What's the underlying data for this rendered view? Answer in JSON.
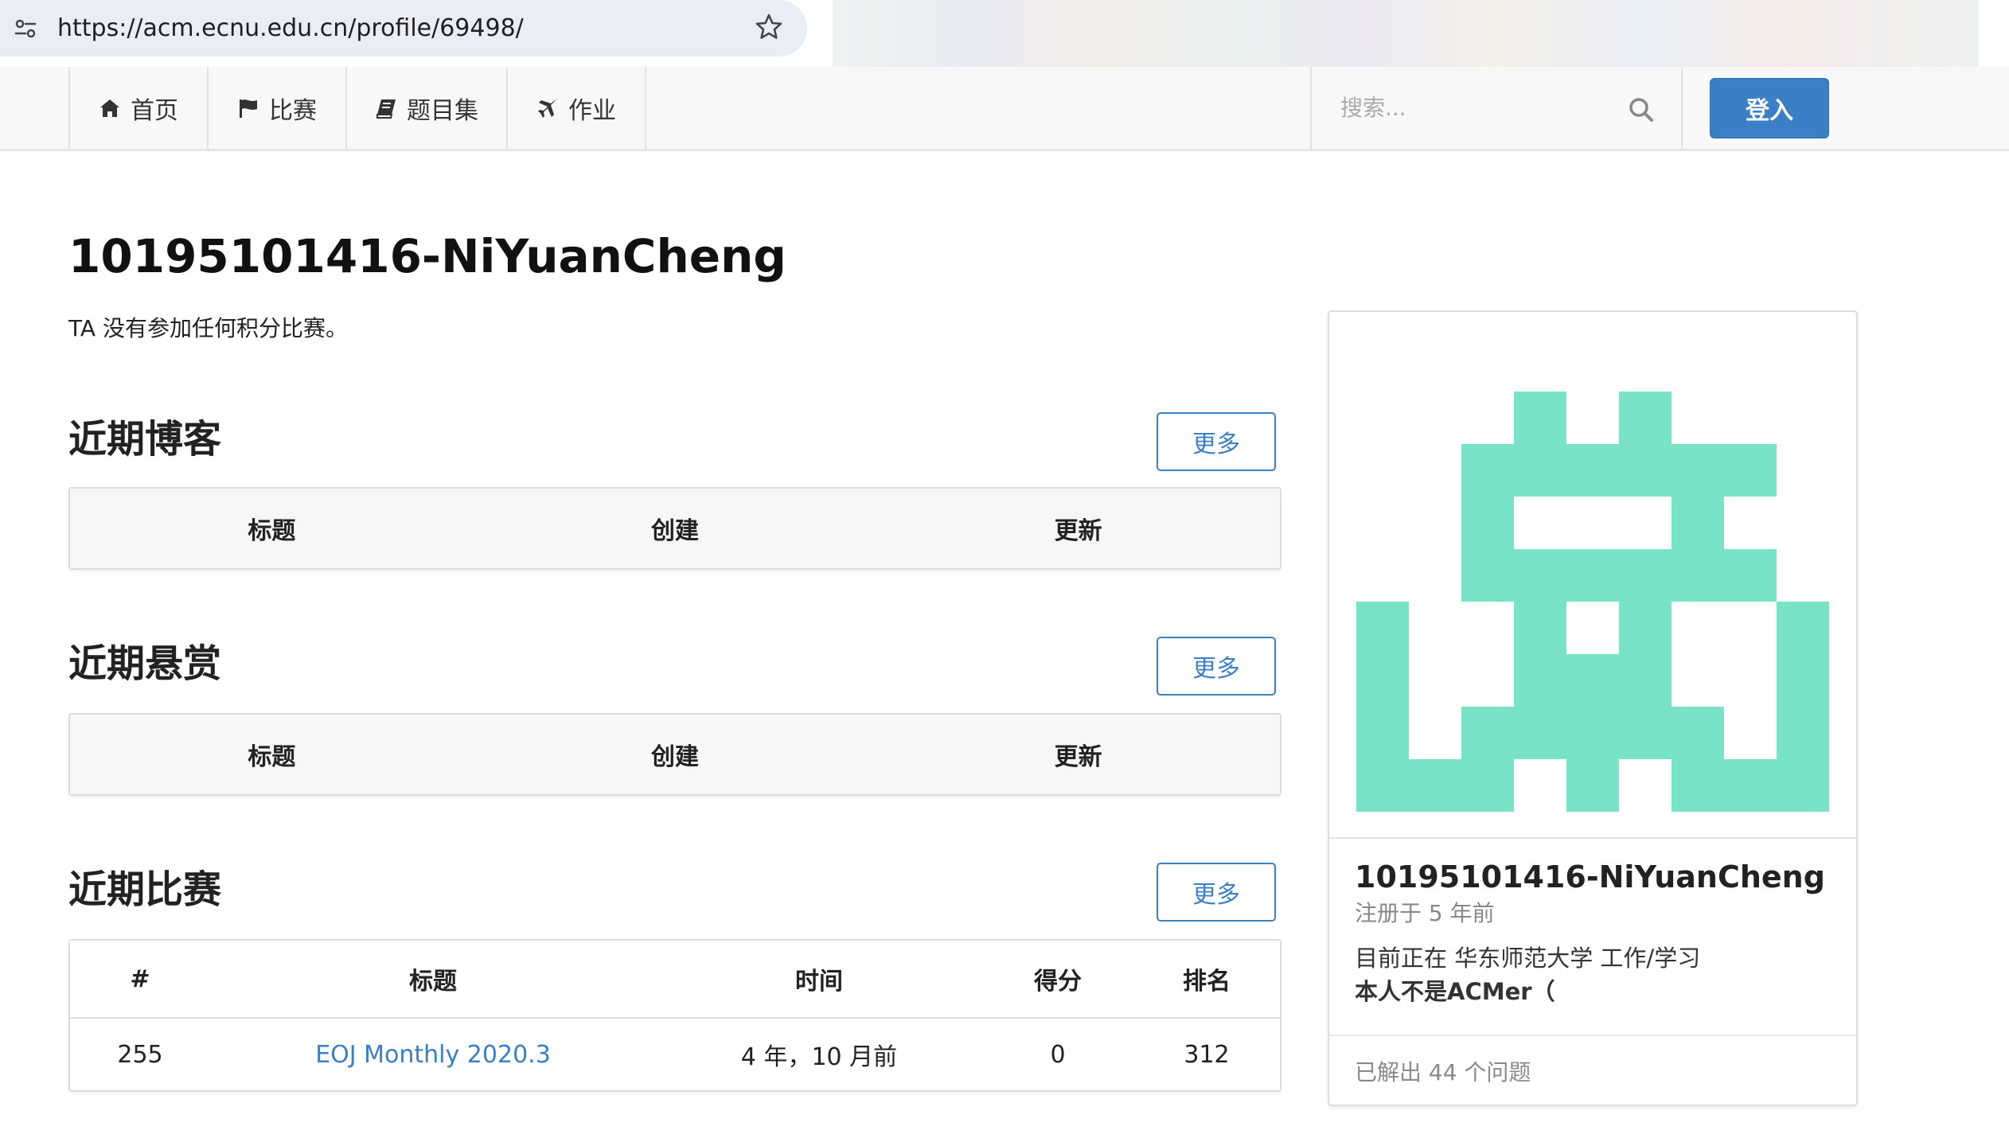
{
  "browser": {
    "url": "https://acm.ecnu.edu.cn/profile/69498/"
  },
  "navbar": {
    "items": [
      {
        "label": "首页",
        "icon": "home-icon"
      },
      {
        "label": "比赛",
        "icon": "flag-icon"
      },
      {
        "label": "题目集",
        "icon": "book-icon"
      },
      {
        "label": "作业",
        "icon": "plane-icon"
      }
    ],
    "search_placeholder": "搜索...",
    "login_label": "登入"
  },
  "profile": {
    "title": "10195101416-NiYuanCheng",
    "rating_note": "TA 没有参加任何积分比赛。"
  },
  "sections": {
    "blogs": {
      "title": "近期博客",
      "more_label": "更多",
      "columns": [
        "标题",
        "创建",
        "更新"
      ]
    },
    "bounties": {
      "title": "近期悬赏",
      "more_label": "更多",
      "columns": [
        "标题",
        "创建",
        "更新"
      ]
    },
    "contests": {
      "title": "近期比赛",
      "more_label": "更多",
      "columns": [
        "#",
        "标题",
        "时间",
        "得分",
        "排名"
      ],
      "rows": [
        {
          "id": "255",
          "title": "EOJ Monthly 2020.3",
          "time": "4 年，10 月前",
          "score": "0",
          "rank": "312"
        }
      ]
    }
  },
  "sidebar": {
    "username": "10195101416-NiYuanCheng",
    "registered": "注册于 5 年前",
    "job": "目前正在 华东师范大学 工作/学习",
    "bio": "本人不是ACMer（",
    "solved": "已解出 44 个问题",
    "avatar_color": "#79e3c7"
  },
  "colors": {
    "accent": "#3b7fc4",
    "navbar_bg": "#f8f8f8"
  }
}
